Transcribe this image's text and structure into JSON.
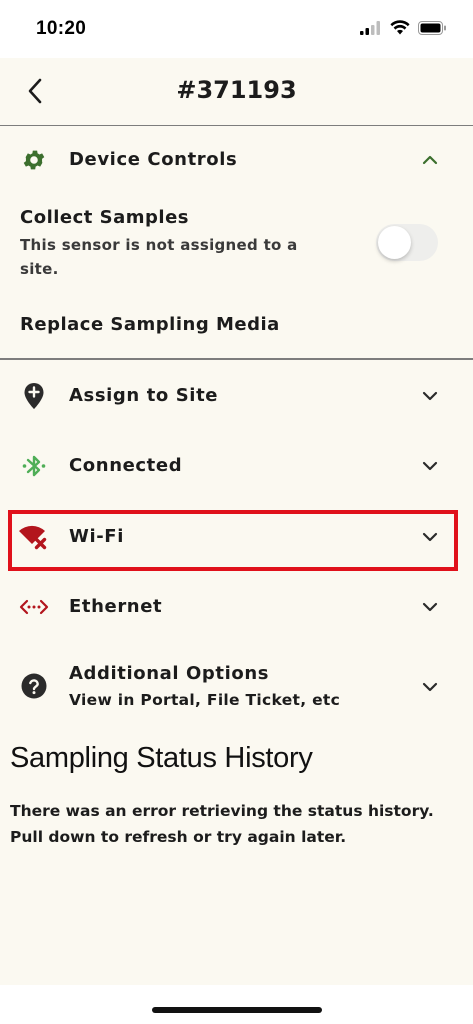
{
  "status_bar": {
    "time": "10:20"
  },
  "header": {
    "title": "#371193"
  },
  "device_controls": {
    "label": "Device Controls",
    "collect_samples": {
      "label": "Collect Samples",
      "note": "This sensor is not assigned to a site.",
      "enabled": false
    },
    "replace_media_label": "Replace Sampling Media"
  },
  "rows": [
    {
      "label": "Assign to Site",
      "icon": "map-pin-plus-icon"
    },
    {
      "label": "Connected",
      "icon": "bluetooth-icon"
    },
    {
      "label": "Wi-Fi",
      "icon": "wifi-off-icon"
    },
    {
      "label": "Ethernet",
      "icon": "ethernet-icon"
    }
  ],
  "additional_options": {
    "label": "Additional Options",
    "sub": "View in Portal, File Ticket, etc"
  },
  "history": {
    "title": "Sampling Status History",
    "message": "There was an error retrieving the status history. Pull down to refresh or try again later."
  },
  "colors": {
    "background": "#fbf9f1",
    "accent_green": "#3c6f2e",
    "bluetooth_green": "#4fae57",
    "error_red": "#b3151d",
    "highlight_red": "#e0111b"
  }
}
